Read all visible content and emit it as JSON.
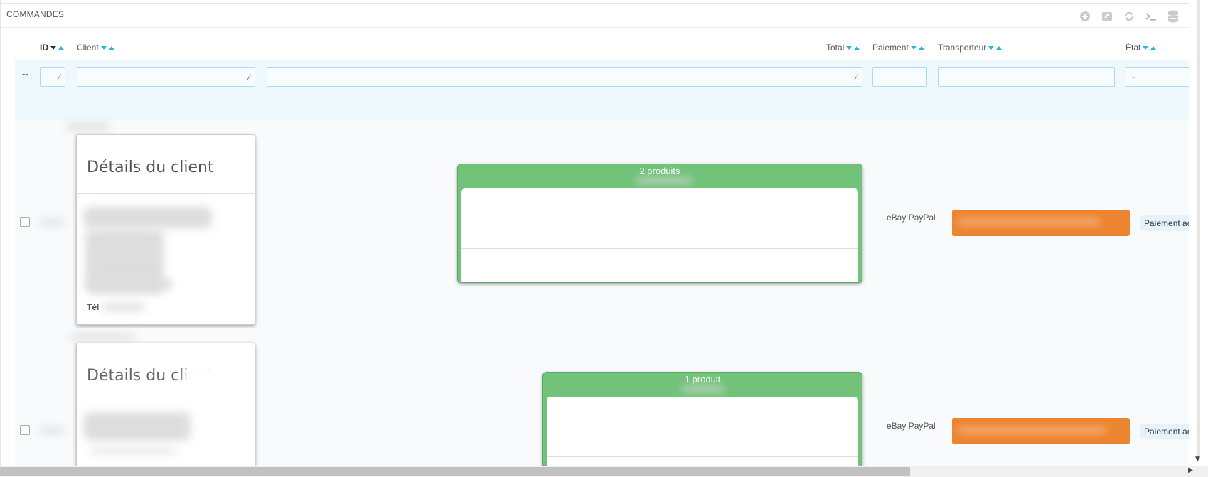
{
  "panel": {
    "title": "COMMANDES"
  },
  "toolbar": [
    "add-icon",
    "export-icon",
    "refresh-icon",
    "sql-query-icon",
    "database-icon"
  ],
  "columns": {
    "id": "ID",
    "client": "Client",
    "total": "Total",
    "payment": "Paiement",
    "carrier": "Transporteur",
    "state": "État"
  },
  "filters": {
    "dashes": "--",
    "state_value": "-"
  },
  "orders": [
    {
      "customer_title": "Détails du client",
      "customer_phone_prefix": "Tél",
      "products_label": "2 produits",
      "payment": "eBay PayPal",
      "state": "Paiement accepté"
    },
    {
      "customer_title": "Détails du client",
      "products_label": "1 produit",
      "payment": "eBay PayPal",
      "state": "Paiement accepté"
    }
  ],
  "colors": {
    "accent": "#25b9d7",
    "product_header": "#72c279",
    "carrier_badge": "#ed842f",
    "state_badge": "#e7f3fb"
  }
}
